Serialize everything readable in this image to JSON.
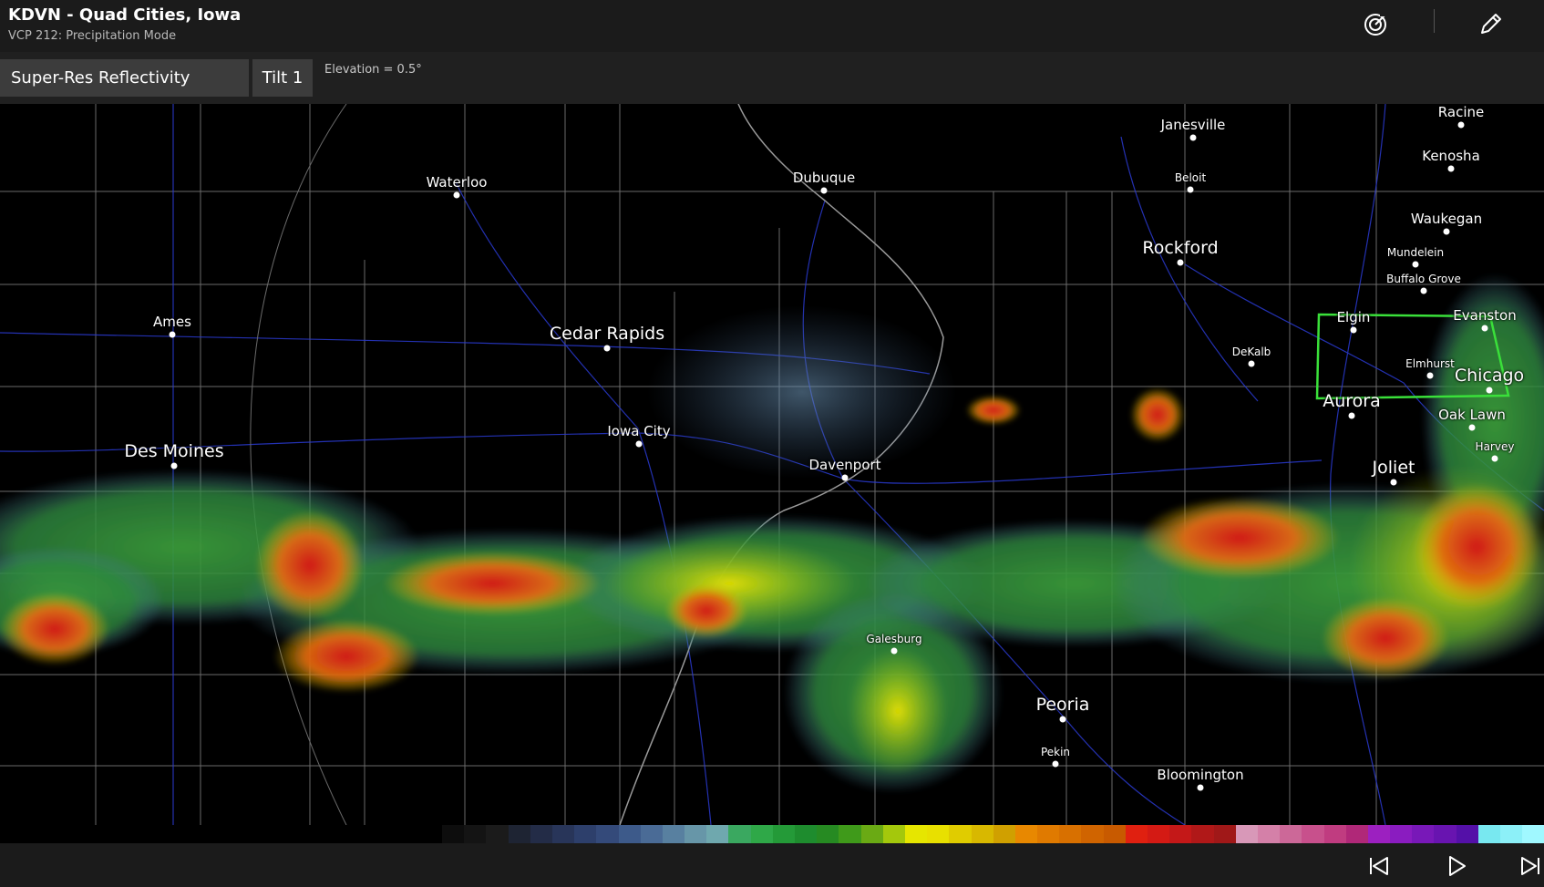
{
  "header": {
    "title": "KDVN - Quad Cities, Iowa",
    "subtitle": "VCP 212: Precipitation Mode"
  },
  "toolbar": {
    "product": "Super-Res Reflectivity",
    "tilt": "Tilt 1",
    "elevation": "Elevation = 0.5°"
  },
  "icons": {
    "header": [
      "radar-target-icon",
      "pencil-icon"
    ],
    "footer": [
      "skip-previous-icon",
      "play-icon",
      "skip-next-icon"
    ]
  },
  "cities": [
    {
      "id": "racine",
      "name": "Racine",
      "size": "sm"
    },
    {
      "id": "janesville",
      "name": "Janesville",
      "size": "sm"
    },
    {
      "id": "kenosha",
      "name": "Kenosha",
      "size": "sm"
    },
    {
      "id": "waterloo",
      "name": "Waterloo",
      "size": "sm"
    },
    {
      "id": "dubuque",
      "name": "Dubuque",
      "size": "sm"
    },
    {
      "id": "beloit",
      "name": "Beloit",
      "size": "xs"
    },
    {
      "id": "waukegan",
      "name": "Waukegan",
      "size": "sm"
    },
    {
      "id": "rockford",
      "name": "Rockford",
      "size": "lg"
    },
    {
      "id": "mundelein",
      "name": "Mundelein",
      "size": "xs"
    },
    {
      "id": "buffalo-grove",
      "name": "Buffalo Grove",
      "size": "xs"
    },
    {
      "id": "ames",
      "name": "Ames",
      "size": "sm"
    },
    {
      "id": "elgin",
      "name": "Elgin",
      "size": "sm"
    },
    {
      "id": "evanston",
      "name": "Evanston",
      "size": "sm"
    },
    {
      "id": "cedar-rapids",
      "name": "Cedar Rapids",
      "size": "lg"
    },
    {
      "id": "dekalb",
      "name": "DeKalb",
      "size": "xs"
    },
    {
      "id": "elmhurst",
      "name": "Elmhurst",
      "size": "xs"
    },
    {
      "id": "chicago",
      "name": "Chicago",
      "size": "lg"
    },
    {
      "id": "aurora",
      "name": "Aurora",
      "size": "lg"
    },
    {
      "id": "oak-lawn",
      "name": "Oak Lawn",
      "size": "sm"
    },
    {
      "id": "iowa-city",
      "name": "Iowa City",
      "size": "sm"
    },
    {
      "id": "harvey",
      "name": "Harvey",
      "size": "xs"
    },
    {
      "id": "des-moines",
      "name": "Des Moines",
      "size": "lg"
    },
    {
      "id": "davenport",
      "name": "Davenport",
      "size": "sm"
    },
    {
      "id": "joliet",
      "name": "Joliet",
      "size": "lg"
    },
    {
      "id": "galesburg",
      "name": "Galesburg",
      "size": "xs"
    },
    {
      "id": "peoria",
      "name": "Peoria",
      "size": "lg"
    },
    {
      "id": "pekin",
      "name": "Pekin",
      "size": "xs"
    },
    {
      "id": "bloomington",
      "name": "Bloomington",
      "size": "sm"
    }
  ],
  "colorbar": [
    "#0d0d0d",
    "#141414",
    "#1b1b1b",
    "#1e2433",
    "#232c47",
    "#283559",
    "#2d3f6b",
    "#344a7a",
    "#3d5a8a",
    "#4a6b96",
    "#5880a0",
    "#6796a8",
    "#6fa8ae",
    "#3aa860",
    "#2fa848",
    "#249a38",
    "#1e8c2e",
    "#268a22",
    "#3f9a1a",
    "#6aaa14",
    "#a4c80c",
    "#e6e600",
    "#e8e000",
    "#e0cc00",
    "#d8b800",
    "#d0a000",
    "#e88800",
    "#e07a00",
    "#d87000",
    "#d06400",
    "#c85a00",
    "#e02010",
    "#d41a14",
    "#c41818",
    "#b01818",
    "#a01818",
    "#d898b8",
    "#d480a8",
    "#cc6898",
    "#c8508c",
    "#c03c80",
    "#b02878",
    "#9c20c0",
    "#8a1cc0",
    "#7818b8",
    "#6814b0",
    "#5410a8",
    "#78e8f0",
    "#8cf0f8",
    "#a0f8ff"
  ]
}
